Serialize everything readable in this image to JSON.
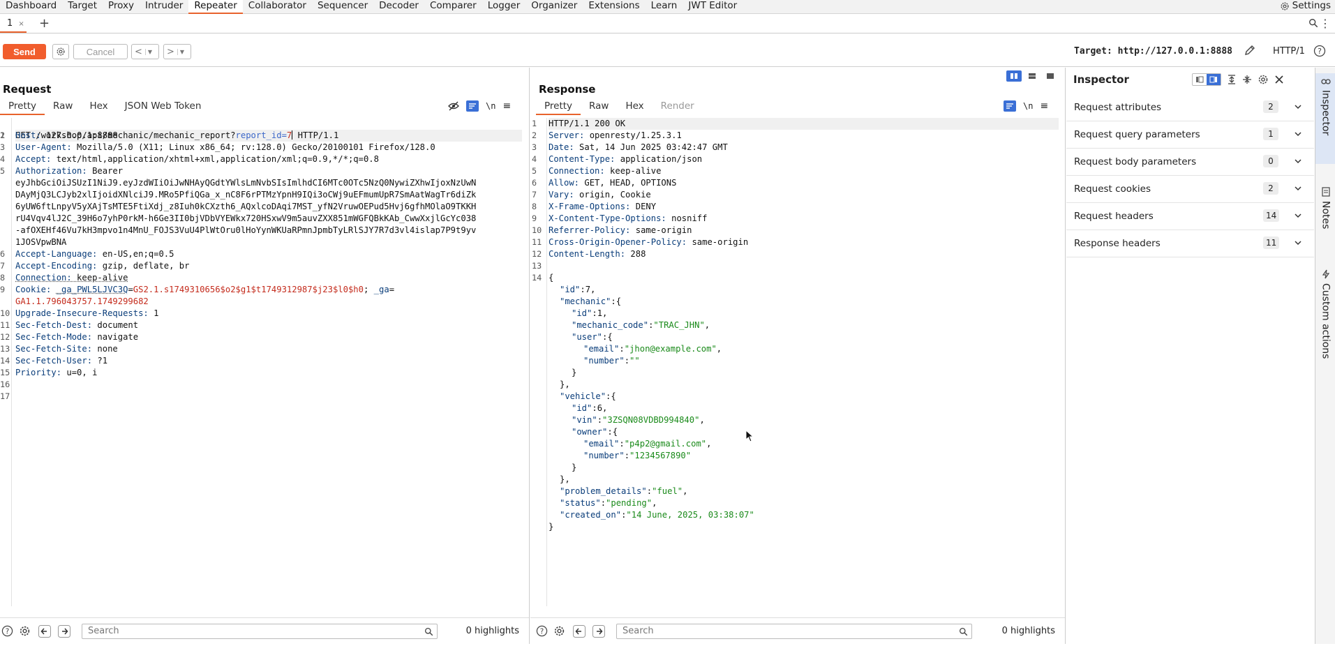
{
  "menu": {
    "items": [
      "Dashboard",
      "Target",
      "Proxy",
      "Intruder",
      "Repeater",
      "Collaborator",
      "Sequencer",
      "Decoder",
      "Comparer",
      "Logger",
      "Organizer",
      "Extensions",
      "Learn",
      "JWT Editor"
    ],
    "active": "Repeater",
    "settings_label": "Settings"
  },
  "tabstrip": {
    "tab_label": "1",
    "tab_close": "×",
    "add_label": "+"
  },
  "toolbar": {
    "send_label": "Send",
    "cancel_label": "Cancel",
    "back_label": "<",
    "forward_label": ">",
    "target_label": "Target: http://127.0.0.1:8888",
    "protocol_label": "HTTP/1"
  },
  "request": {
    "title": "Request",
    "tabs": [
      "Pretty",
      "Raw",
      "Hex",
      "JSON Web Token"
    ],
    "active_tab": "Pretty",
    "search_placeholder": "Search",
    "highlights": "0 highlights",
    "lines": {
      "l1_method": "GET /workshop/api/mechanic/mechanic_report?",
      "l1_qk": "report_id",
      "l1_eq": "=",
      "l1_qv": "7",
      "l1_proto": " HTTP/1.1",
      "l2_k": "Host:",
      "l2_v": " 127.0.0.1:8888",
      "l3_k": "User-Agent:",
      "l3_v": " Mozilla/5.0 (X11; Linux x86_64; rv:128.0) Gecko/20100101 Firefox/128.0",
      "l4_k": "Accept:",
      "l4_v": " text/html,application/xhtml+xml,application/xml;q=0.9,*/*;q=0.8",
      "l5_k": "Authorization:",
      "l5_v": " Bearer",
      "l5_t1": "eyJhbGciOiJSUzI1NiJ9.eyJzdWIiOiJwNHAyQGdtYWlsLmNvbSIsImlhdCI6MTc0OTc5NzQ0NywiZXhwIjoxNzUwN",
      "l5_t2": "DAyMjQ3LCJyb2xlIjoidXNlciJ9.MRo5PfiQGa_x_nC8F6rPTMzYpnH9IQi3oCWj9uEFmumUpR7SmAatWagTr6diZk",
      "l5_t3": "6yUW6ftLnpyV5yXAjTsMTE5FtiXdj_z8Iuh0kCXzth6_AQxlcoDAqi7MST_yfN2VruwOEPud5Hvj6gfhMOlaO9TKKH",
      "l5_t4": "rU4Vqv4lJ2C_39H6o7yhP0rkM-h6Ge3II0bjVDbVYEWkx720HSxwV9m5auvZXX851mWGFQBkKAb_CwwXxjlGcYc038",
      "l5_t5": "-afOXEHf46Vu7kH3mpvo1n4MnU_FOJS3VuU4PlWtOru0lHoYynWKUaRPmnJpmbTyLRlSJY7R7d3vl4islap7P9t9yv",
      "l5_t6": "1JOSVpwBNA",
      "l6_k": "Accept-Language:",
      "l6_v": " en-US,en;q=0.5",
      "l7_k": "Accept-Encoding:",
      "l7_v": " gzip, deflate, br",
      "l8_k": "Connection:",
      "l8_v": " keep-alive",
      "l9_k": "Cookie:",
      "l9_c1k": "_ga_PWL5LJVC3Q",
      "l9_c1v": "GS2.1.s1749310656$o2$g1$t1749312987$j23$l0$h0",
      "l9_sep": "; ",
      "l9_c2k": "_ga",
      "l9_c2v": "GA1.1.796043757.1749299682",
      "l10_k": "Upgrade-Insecure-Requests:",
      "l10_v": " 1",
      "l11_k": "Sec-Fetch-Dest:",
      "l11_v": " document",
      "l12_k": "Sec-Fetch-Mode:",
      "l12_v": " navigate",
      "l13_k": "Sec-Fetch-Site:",
      "l13_v": " none",
      "l14_k": "Sec-Fetch-User:",
      "l14_v": " ?1",
      "l15_k": "Priority:",
      "l15_v": " u=0, i"
    }
  },
  "response": {
    "title": "Response",
    "tabs": [
      "Pretty",
      "Raw",
      "Hex",
      "Render"
    ],
    "active_tab": "Pretty",
    "search_placeholder": "Search",
    "highlights": "0 highlights",
    "lines": {
      "l1": "HTTP/1.1 200 OK",
      "l2_k": "Server:",
      "l2_v": " openresty/1.25.3.1",
      "l3_k": "Date:",
      "l3_v": " Sat, 14 Jun 2025 03:42:47 GMT",
      "l4_k": "Content-Type:",
      "l4_v": " application/json",
      "l5_k": "Connection:",
      "l5_v": " keep-alive",
      "l6_k": "Allow:",
      "l6_v": " GET, HEAD, OPTIONS",
      "l7_k": "Vary:",
      "l7_v": " origin, Cookie",
      "l8_k": "X-Frame-Options:",
      "l8_v": " DENY",
      "l9_k": "X-Content-Type-Options:",
      "l9_v": " nosniff",
      "l10_k": "Referrer-Policy:",
      "l10_v": " same-origin",
      "l11_k": "Cross-Origin-Opener-Policy:",
      "l11_v": " same-origin",
      "l12_k": "Content-Length:",
      "l12_v": " 288",
      "j_open": "{",
      "j_id_k": "\"id\"",
      "j_id_v": ":7,",
      "j_mech_k": "\"mechanic\"",
      "j_mech_v": ":{",
      "j_mid_k": "\"id\"",
      "j_mid_v": ":1,",
      "j_mcode_k": "\"mechanic_code\"",
      "j_mcode_v": "\"TRAC_JHN\"",
      "j_user_k": "\"user\"",
      "j_user_v": ":{",
      "j_uemail_k": "\"email\"",
      "j_uemail_v": "\"jhon@example.com\"",
      "j_unum_k": "\"number\"",
      "j_unum_v": "\"\"",
      "j_close": "}",
      "j_close_c": "},",
      "j_veh_k": "\"vehicle\"",
      "j_veh_v": ":{",
      "j_vid_k": "\"id\"",
      "j_vid_v": ":6,",
      "j_vin_k": "\"vin\"",
      "j_vin_v": "\"3ZSQN08VDBD994840\"",
      "j_own_k": "\"owner\"",
      "j_own_v": ":{",
      "j_oemail_k": "\"email\"",
      "j_oemail_v": "\"p4p2@gmail.com\"",
      "j_onum_k": "\"number\"",
      "j_onum_v": "\"1234567890\"",
      "j_prob_k": "\"problem_details\"",
      "j_prob_v": "\"fuel\"",
      "j_stat_k": "\"status\"",
      "j_stat_v": "\"pending\"",
      "j_cre_k": "\"created_on\"",
      "j_cre_v": "\"14 June, 2025, 03:38:07\"",
      "colon": ":",
      "comma": ","
    }
  },
  "inspector": {
    "title": "Inspector",
    "sections": [
      {
        "label": "Request attributes",
        "count": "2"
      },
      {
        "label": "Request query parameters",
        "count": "1"
      },
      {
        "label": "Request body parameters",
        "count": "0"
      },
      {
        "label": "Request cookies",
        "count": "2"
      },
      {
        "label": "Request headers",
        "count": "14"
      },
      {
        "label": "Response headers",
        "count": "11"
      }
    ]
  },
  "rail": {
    "inspector": "Inspector",
    "notes": "Notes",
    "custom_actions": "Custom actions"
  },
  "colors": {
    "accent": "#e8622c",
    "send": "#f15d2d",
    "toggle": "#3a6fd6"
  }
}
